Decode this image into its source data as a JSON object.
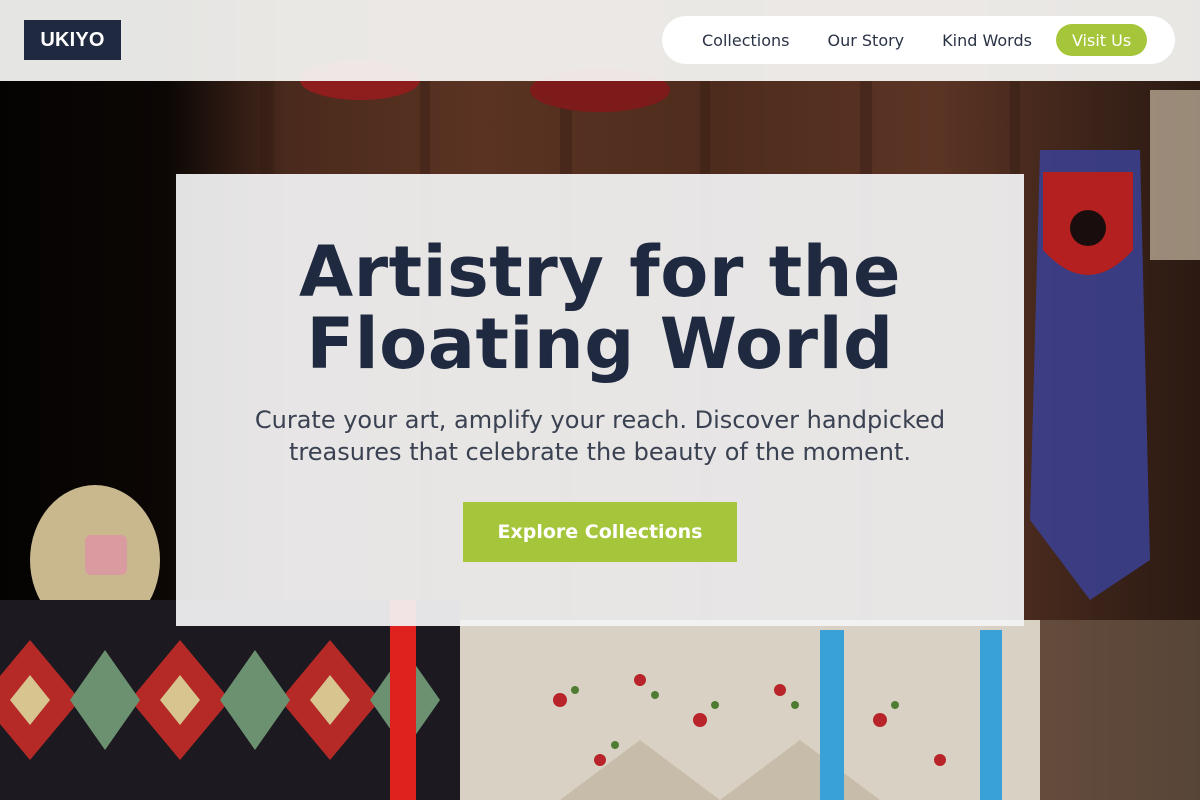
{
  "header": {
    "logo": "UKIYO",
    "nav": {
      "items": [
        {
          "label": "Collections"
        },
        {
          "label": "Our Story"
        },
        {
          "label": "Kind Words"
        }
      ],
      "cta": "Visit Us"
    }
  },
  "hero": {
    "title_line1": "Artistry for the",
    "title_line2": "Floating World",
    "subtitle_line1": "Curate your art, amplify your reach. Discover handpicked",
    "subtitle_line2": "treasures that celebrate the beauty of the moment.",
    "button": "Explore Collections",
    "background_image": "market-stall-textiles-photo"
  },
  "colors": {
    "navy": "#1f2a40",
    "accent_green": "#a5c63b",
    "header_bg": "#f6f6f4",
    "card_bg": "#f3f3f4"
  }
}
